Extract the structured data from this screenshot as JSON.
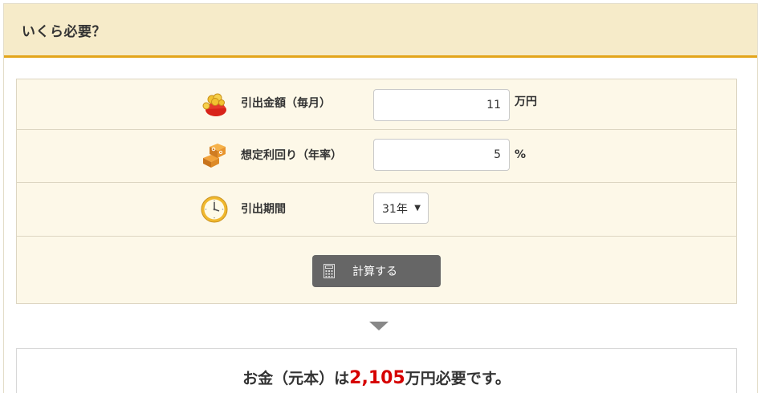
{
  "header": {
    "title": "いくら必要？"
  },
  "form": {
    "withdrawal": {
      "label": "引出金額（毎月）",
      "value": "11",
      "unit": "万円",
      "icon": "money-bag-icon"
    },
    "yield": {
      "label": "想定利回り（年率）",
      "value": "5",
      "unit": "%",
      "icon": "percent-blocks-icon"
    },
    "period": {
      "label": "引出期間",
      "selected": "31年",
      "icon": "clock-icon"
    },
    "calculate_button": {
      "label": "計算する",
      "icon": "calculator-icon"
    }
  },
  "result": {
    "prefix": "お金（元本）は",
    "amount": "2,105",
    "suffix": "万円必要です。"
  },
  "colors": {
    "header_bg": "#f6ebc9",
    "header_border": "#e3a51b",
    "form_bg": "#fdf8e8",
    "button_bg": "#666666",
    "result_amount": "#d60000"
  }
}
